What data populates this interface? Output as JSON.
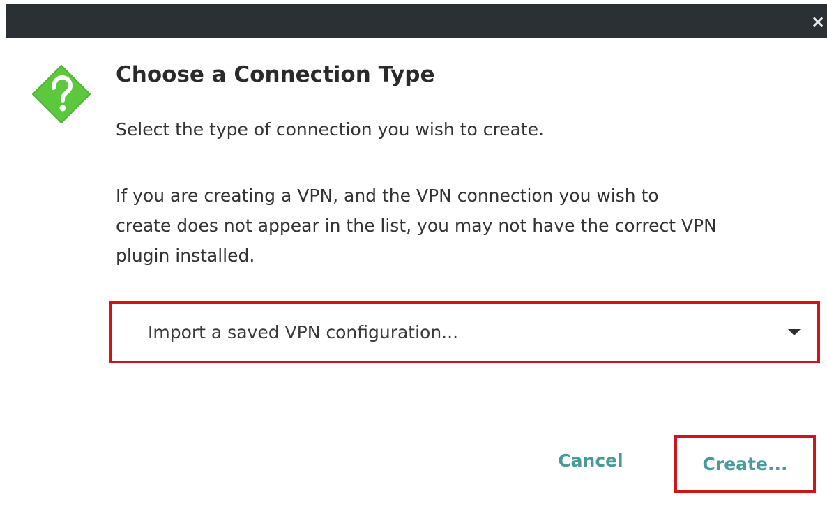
{
  "dialog": {
    "close_glyph": "×",
    "title": "Choose a Connection Type",
    "subtitle": "Select the type of connection you wish to create.",
    "description_lines": [
      "If you are creating a VPN, and the VPN connection you wish to",
      "create does not appear in the list, you may not have the correct VPN",
      "plugin installed."
    ],
    "icon": "question-diamond-icon",
    "icon_color": "#5cc83e"
  },
  "connection_type": {
    "selected": "Import a saved VPN configuration..."
  },
  "buttons": {
    "cancel_label": "Cancel",
    "create_label": "Create..."
  },
  "colors": {
    "titlebar": "#2b3034",
    "button_text": "#4a9a98",
    "highlight_border": "#d0141c"
  }
}
